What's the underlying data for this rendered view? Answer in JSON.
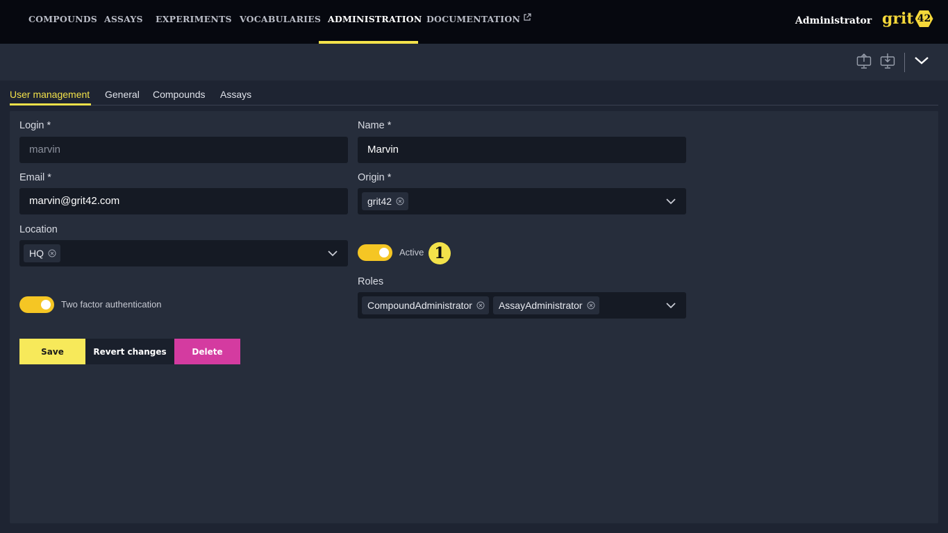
{
  "nav": {
    "items": [
      {
        "label": "COMPOUNDS"
      },
      {
        "label": "ASSAYS"
      },
      {
        "label": "EXPERIMENTS"
      },
      {
        "label": "VOCABULARIES"
      },
      {
        "label": "ADMINISTRATION"
      },
      {
        "label": "DOCUMENTATION"
      }
    ],
    "active": "ADMINISTRATION",
    "user": "Administrator",
    "logo_text": "grit",
    "logo_badge": "42"
  },
  "toolbar": {
    "icons": [
      "upload-icon",
      "download-icon",
      "chevron-down-icon"
    ]
  },
  "tabs": {
    "items": [
      {
        "label": "User management"
      },
      {
        "label": "General"
      },
      {
        "label": "Compounds"
      },
      {
        "label": "Assays"
      }
    ],
    "active": "User management"
  },
  "form": {
    "login": {
      "label": "Login *",
      "value": "marvin"
    },
    "name": {
      "label": "Name *",
      "value": "Marvin"
    },
    "email": {
      "label": "Email *",
      "value": "marvin@grit42.com"
    },
    "origin": {
      "label": "Origin *",
      "chips": [
        "grit42"
      ]
    },
    "location": {
      "label": "Location",
      "chips": [
        "HQ"
      ]
    },
    "active": {
      "label": "Active",
      "on": true
    },
    "two_factor": {
      "label": "Two factor authentication",
      "on": true
    },
    "roles": {
      "label": "Roles",
      "chips": [
        "CompoundAdministrator",
        "AssayAdministrator"
      ]
    },
    "callout": "1"
  },
  "buttons": {
    "save": "Save",
    "revert": "Revert changes",
    "delete": "Delete"
  },
  "colors": {
    "accent": "#f3e24a",
    "toggle": "#f5c624",
    "delete": "#d43ba0",
    "nav_bg": "#06080f",
    "page_bg": "#1e2432"
  }
}
